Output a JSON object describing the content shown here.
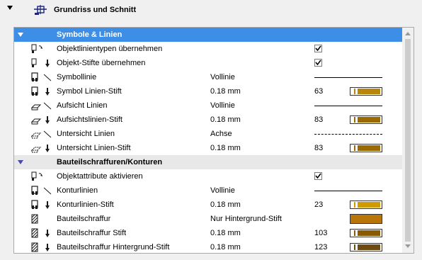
{
  "header": {
    "title": "Grundriss und Schnitt",
    "icon": "floorplan-section-icon"
  },
  "sections": [
    {
      "title": "Symbole & Linien",
      "selected": true,
      "rows": [
        {
          "icon": "object-linetype-icon",
          "label": "Objektlinientypen übernehmen",
          "checked": true
        },
        {
          "icon": "object-pen-icon",
          "label": "Objekt-Stifte übernehmen",
          "checked": true
        },
        {
          "icon": "symbol-line-icon",
          "label": "Symbollinie",
          "value": "Vollinie",
          "line": "solid"
        },
        {
          "icon": "symbol-line-pen-icon",
          "label": "Symbol Linien-Stift",
          "value": "0.18 mm",
          "pen_number": "63",
          "pen_color": "#b8860b"
        },
        {
          "icon": "overhead-line-icon",
          "label": "Aufsicht Linien",
          "value": "Vollinie",
          "line": "solid"
        },
        {
          "icon": "overhead-line-pen-icon",
          "label": "Aufsichtslinien-Stift",
          "value": "0.18 mm",
          "pen_number": "83",
          "pen_color": "#9a6a00"
        },
        {
          "icon": "below-line-icon",
          "label": "Untersicht Linien",
          "value": "Achse",
          "line": "dashed"
        },
        {
          "icon": "below-line-pen-icon",
          "label": "Untersicht Linien-Stift",
          "value": "0.18 mm",
          "pen_number": "83",
          "pen_color": "#9a6a00"
        }
      ]
    },
    {
      "title": "Bauteilschraffuren/Konturen",
      "selected": false,
      "rows": [
        {
          "icon": "object-attributes-icon",
          "label": "Objektattribute aktivieren",
          "checked": true
        },
        {
          "icon": "contour-line-icon",
          "label": "Konturlinien",
          "value": "Vollinie",
          "line": "solid"
        },
        {
          "icon": "contour-pen-icon",
          "label": "Konturlinien-Stift",
          "value": "0.18 mm",
          "pen_number": "23",
          "pen_color": "#d19a00"
        },
        {
          "icon": "fill-icon",
          "label": "Bauteilschraffur",
          "value": "Nur Hintergrund-Stift",
          "fill_color": "#b8760a"
        },
        {
          "icon": "fill-pen-icon",
          "label": "Bauteilschraffur Stift",
          "value": "0.18 mm",
          "pen_number": "103",
          "pen_color": "#8a5a00"
        },
        {
          "icon": "fill-background-pen-icon",
          "label": "Bauteilschraffur Hintergrund-Stift",
          "value": "0.18 mm",
          "pen_number": "123",
          "pen_color": "#6e4a10"
        }
      ]
    }
  ]
}
